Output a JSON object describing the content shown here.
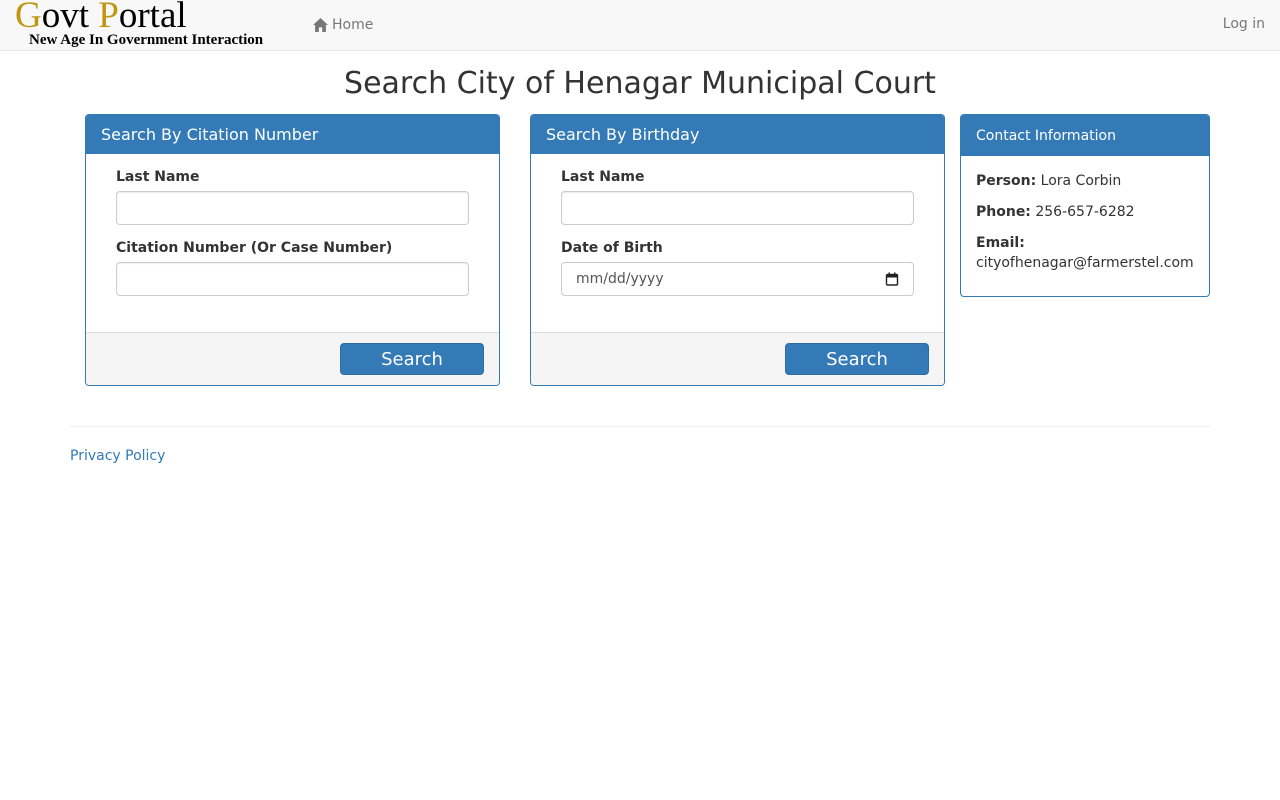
{
  "navbar": {
    "brand": {
      "g": "G",
      "ovt": "ovt ",
      "p": "P",
      "ortal": "ortal",
      "tagline": "New Age In Government Interaction"
    },
    "home_label": "Home",
    "home_icon": "home-icon",
    "login_label": "Log in"
  },
  "page_title": "Search City of Henagar Municipal Court",
  "citation_panel": {
    "heading": "Search By Citation Number",
    "last_name_label": "Last Name",
    "last_name_value": "",
    "citation_label": "Citation Number (Or Case Number)",
    "citation_value": "",
    "search_label": "Search"
  },
  "birthday_panel": {
    "heading": "Search By Birthday",
    "last_name_label": "Last Name",
    "last_name_value": "",
    "dob_label": "Date of Birth",
    "dob_placeholder": "mm/dd/yyyy",
    "calendar_icon": "calendar-icon",
    "search_label": "Search"
  },
  "contact_panel": {
    "heading": "Contact Information",
    "person_label": "Person:",
    "person_value": "Lora Corbin",
    "phone_label": "Phone:",
    "phone_value": "256-657-6282",
    "email_label": "Email:",
    "email_value": "cityofhenagar@farmerstel.com"
  },
  "footer": {
    "privacy_label": "Privacy Policy"
  },
  "colors": {
    "primary": "#337ab7",
    "brand_gold": "#c09510",
    "navbar_bg": "#f8f8f8",
    "footer_panel_bg": "#f5f5f5"
  }
}
